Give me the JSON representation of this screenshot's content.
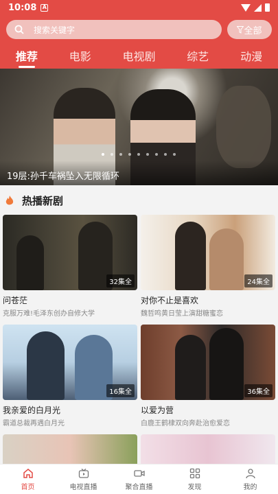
{
  "status_bar": {
    "time": "10:08",
    "notification_glyph": "A"
  },
  "search": {
    "placeholder": "搜索关键字",
    "filter_label": "全部"
  },
  "tabs": [
    {
      "label": "推荐",
      "active": true
    },
    {
      "label": "电影",
      "active": false
    },
    {
      "label": "电视剧",
      "active": false
    },
    {
      "label": "综艺",
      "active": false
    },
    {
      "label": "动漫",
      "active": false
    }
  ],
  "banner": {
    "caption": "19层:孙千车祸坠入无限循环",
    "slide_count": 9,
    "active_slide": 1
  },
  "section": {
    "title": "热播新剧"
  },
  "dramas": [
    {
      "title": "问苍茫",
      "subtitle": "克服万难!毛泽东创办自修大学",
      "badge": "32集全"
    },
    {
      "title": "对你不止是喜欢",
      "subtitle": "魏哲鸣黄日莹上演甜糖蜜恋",
      "badge": "24集全"
    },
    {
      "title": "我亲爱的白月光",
      "subtitle": "霸道总裁再遇白月光",
      "badge": "16集全"
    },
    {
      "title": "以爱为营",
      "subtitle": "白鹿王鹤棣双向奔赴治愈爱恋",
      "badge": "36集全"
    },
    {
      "title": "",
      "subtitle": "",
      "badge": ""
    },
    {
      "title": "",
      "subtitle": "",
      "badge": ""
    }
  ],
  "bottom_nav": [
    {
      "label": "首页",
      "active": true
    },
    {
      "label": "电视直播",
      "active": false
    },
    {
      "label": "聚合直播",
      "active": false
    },
    {
      "label": "发现",
      "active": false
    },
    {
      "label": "我的",
      "active": false
    }
  ],
  "colors": {
    "brand": "#e34b45",
    "search_bg": "#f1c1bd"
  }
}
